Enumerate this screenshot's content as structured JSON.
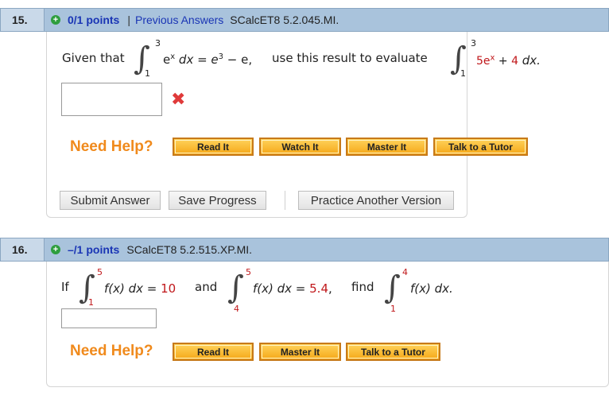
{
  "q15": {
    "number": "15.",
    "plus": "+",
    "points": "0/1 points",
    "separator": "|",
    "previous_answers": "Previous Answers",
    "qid": "SCalcET8 5.2.045.MI.",
    "given_that": "Given that",
    "int1_upper": "3",
    "int1_lower": "1",
    "int1_body": "e",
    "int1_exp": "x",
    "int1_dx": " dx = e",
    "int1_rhs_exp": "3",
    "int1_rhs_tail": " − e,",
    "use_text": "use this result to evaluate",
    "int2_upper": "3",
    "int2_lower": "1",
    "int2_coef": "5e",
    "int2_exp": "x",
    "int2_plus": " + ",
    "int2_const": "4",
    "int2_dx": " dx.",
    "answer_value": "",
    "incorrect_mark": "✖",
    "need_help": "Need Help?",
    "help_buttons": [
      "Read It",
      "Watch It",
      "Master It",
      "Talk to a Tutor"
    ],
    "submit": "Submit Answer",
    "save": "Save Progress",
    "practice": "Practice Another Version"
  },
  "q16": {
    "number": "16.",
    "plus": "+",
    "points": "–/1 points",
    "qid": "SCalcET8 5.2.515.XP.MI.",
    "if_text": "If",
    "a_upper": "5",
    "a_lower": "1",
    "a_body": "f(x) dx = ",
    "a_value": "10",
    "and_text": "and",
    "b_upper": "5",
    "b_lower": "4",
    "b_body": "f(x) dx = ",
    "b_value": "5.4",
    "comma": ",",
    "find_text": "find",
    "c_upper": "4",
    "c_lower": "1",
    "c_body": "f(x) dx.",
    "answer_value": "",
    "need_help": "Need Help?",
    "help_buttons": [
      "Read It",
      "Master It",
      "Talk to a Tutor"
    ]
  },
  "colors": {
    "header_bg": "#a9c3dc",
    "points_blue": "#1a35b5",
    "need_help_orange": "#f08a1c",
    "error_red": "#e03a3a",
    "value_red": "#c0171a"
  }
}
